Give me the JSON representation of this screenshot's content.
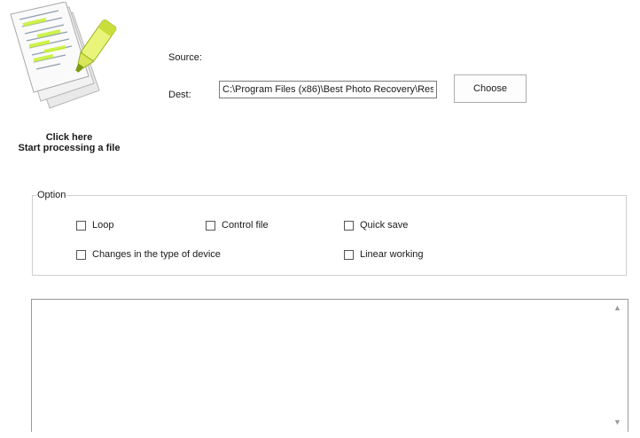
{
  "header": {
    "click_caption_line1": "Click here",
    "click_caption_line2": "Start processing a file",
    "icon": "document-highlighter-icon"
  },
  "fields": {
    "source_label": "Source:",
    "dest_label": "Dest:",
    "dest_value": "C:\\Program Files (x86)\\Best Photo Recovery\\Res",
    "choose_label": "Choose"
  },
  "options": {
    "group_label": "Option",
    "loop": "Loop",
    "control_file": "Control file",
    "quick_save": "Quick save",
    "changes_device": "Changes in the type of device",
    "linear_working": "Linear working"
  },
  "log": {
    "scroll_up_icon": "scroll-up-arrow-icon",
    "scroll_down_icon": "scroll-down-arrow-icon"
  }
}
